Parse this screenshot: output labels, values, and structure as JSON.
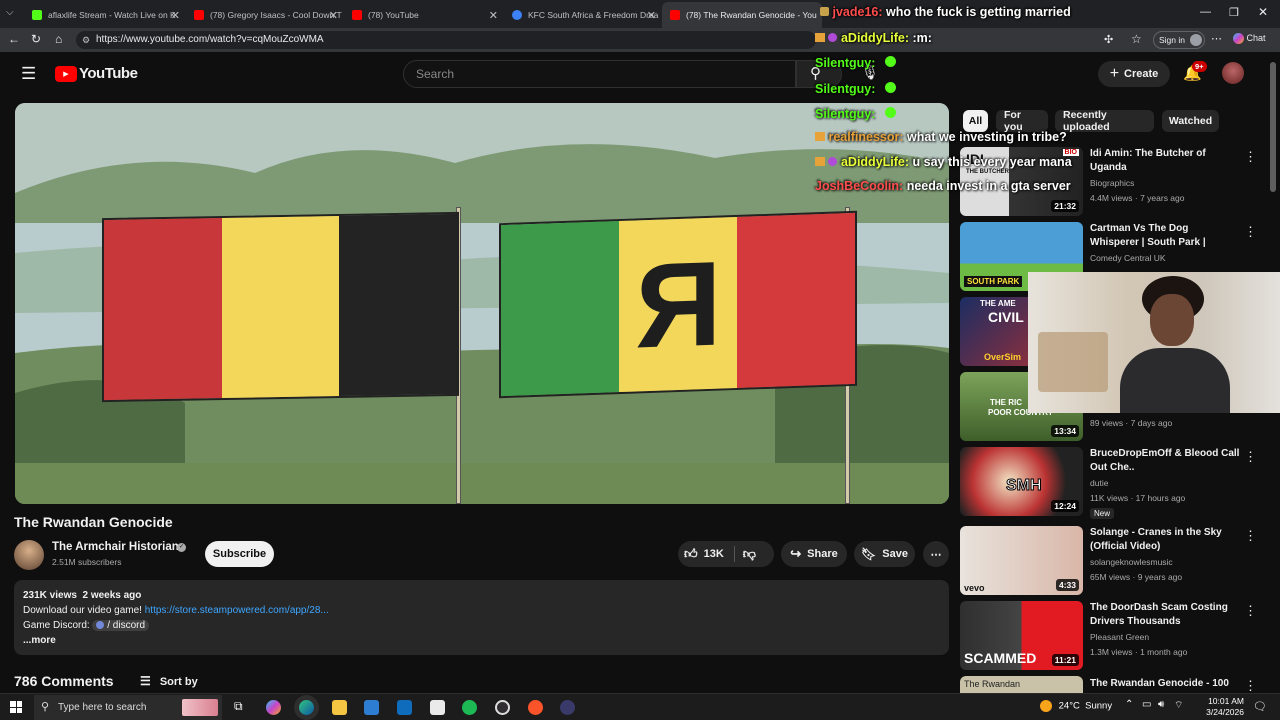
{
  "browser": {
    "tabs": [
      {
        "title": "aflaxlife Stream - Watch Live on K",
        "color": "#53fc18"
      },
      {
        "title": "(78) Gregory Isaacs - Cool Down T",
        "color": "#ff0000"
      },
      {
        "title": "(78) YouTube",
        "color": "#ff0000"
      },
      {
        "title": "KFC South Africa & Freedom Drea",
        "color": "#3c82f6"
      },
      {
        "title": "(78) The Rwandan Genocide - You",
        "color": "#ff0000"
      }
    ],
    "url": "https://www.youtube.com/watch?v=cqMouZcoWMA",
    "signin_label": "Sign in",
    "chat_label": "Chat"
  },
  "youtube": {
    "logo_text": "YouTube",
    "search_placeholder": "Search",
    "create_label": "Create",
    "notif_count": "9+"
  },
  "video": {
    "title": "The Rwandan Genocide",
    "channel": "The Armchair Historian",
    "subscribers": "2.51M subscribers",
    "subscribe_label": "Subscribe",
    "likes": "13K",
    "share_label": "Share",
    "save_label": "Save",
    "flag_letter": "R"
  },
  "description": {
    "views_date": "231K views  2 weeks ago",
    "line1_prefix": "Download our video game! ",
    "line1_link": "https://store.steampowered.com/app/28...",
    "line2_prefix": "Game Discord: ",
    "line2_link": "/ discord",
    "more": "...more"
  },
  "comments": {
    "count": "786 Comments",
    "sort_label": "Sort by"
  },
  "chips": [
    "All",
    "For you",
    "Recently uploaded",
    "Watched"
  ],
  "recommendations": [
    {
      "title": "Idi Amin: The Butcher of Uganda",
      "channel": "Biographics",
      "meta": "4.4M views · 7 years ago",
      "duration": "21:32"
    },
    {
      "title": "Cartman Vs The Dog Whisperer | South Park | Comedy Central ...",
      "channel": "Comedy Central UK",
      "meta": "",
      "duration": ""
    },
    {
      "title": "",
      "channel": "",
      "meta": "",
      "duration": ""
    },
    {
      "title": "",
      "channel": "",
      "meta": "89 views · 7 days ago",
      "duration": "13:34"
    },
    {
      "title": "BruceDropEmOff & Bleood Call Out Che..",
      "channel": "dutie",
      "meta": "11K views · 17 hours ago",
      "duration": "12:24",
      "badge": "New"
    },
    {
      "title": "Solange - Cranes in the Sky (Official Video)",
      "channel": "solangeknowlesmusic",
      "meta": "65M views · 9 years ago",
      "duration": "4:33"
    },
    {
      "title": "The DoorDash Scam Costing Drivers Thousands",
      "channel": "Pleasant Green",
      "meta": "1.3M views · 1 month ago",
      "duration": "11:21"
    },
    {
      "title": "The Rwandan Genocide - 100",
      "channel": "",
      "meta": "",
      "duration": ""
    }
  ],
  "thumb_texts": {
    "rec1_top": "IDI",
    "rec1_sub": "THE BUTCHER",
    "rec1_bio": "BIO",
    "rec2_text": "SOUTH PARK",
    "rec3_top": "THE AME",
    "rec3_mid": "CIVIL",
    "rec3_bot": "OverSim",
    "rec4_top": "THE RIC",
    "rec4_bot": "POOR COUNTRY",
    "rec5_text": "SMH",
    "rec6_text": "vevo",
    "rec7_text": "SCAMMED",
    "rec8_text": "The Rwandan"
  },
  "stream_chat": [
    {
      "user": "jvade16:",
      "msg": "who the fuck is getting married",
      "color": "#ff4d4d"
    },
    {
      "user": "aDiddyLife:",
      "msg": ":m:",
      "color": "#e8ff3a"
    },
    {
      "user": "Silentguy:",
      "msg": "",
      "color": "#53fc18"
    },
    {
      "user": "Silentguy:",
      "msg": "",
      "color": "#53fc18"
    },
    {
      "user": "Silentguy:",
      "msg": "",
      "color": "#53fc18"
    },
    {
      "user": "realfinessor:",
      "msg": "what we investing in tribe?",
      "color": "#e8a23a"
    },
    {
      "user": "aDiddyLife:",
      "msg": "u say this every year mana",
      "color": "#e8ff3a"
    },
    {
      "user": "JoshBeCoolin:",
      "msg": "needa invest in a gta server",
      "color": "#ff4d4d"
    }
  ],
  "taskbar": {
    "search_placeholder": "Type here to search",
    "weather": "24°C  Sunny",
    "time": "10:01 AM",
    "date": "3/24/2026"
  }
}
